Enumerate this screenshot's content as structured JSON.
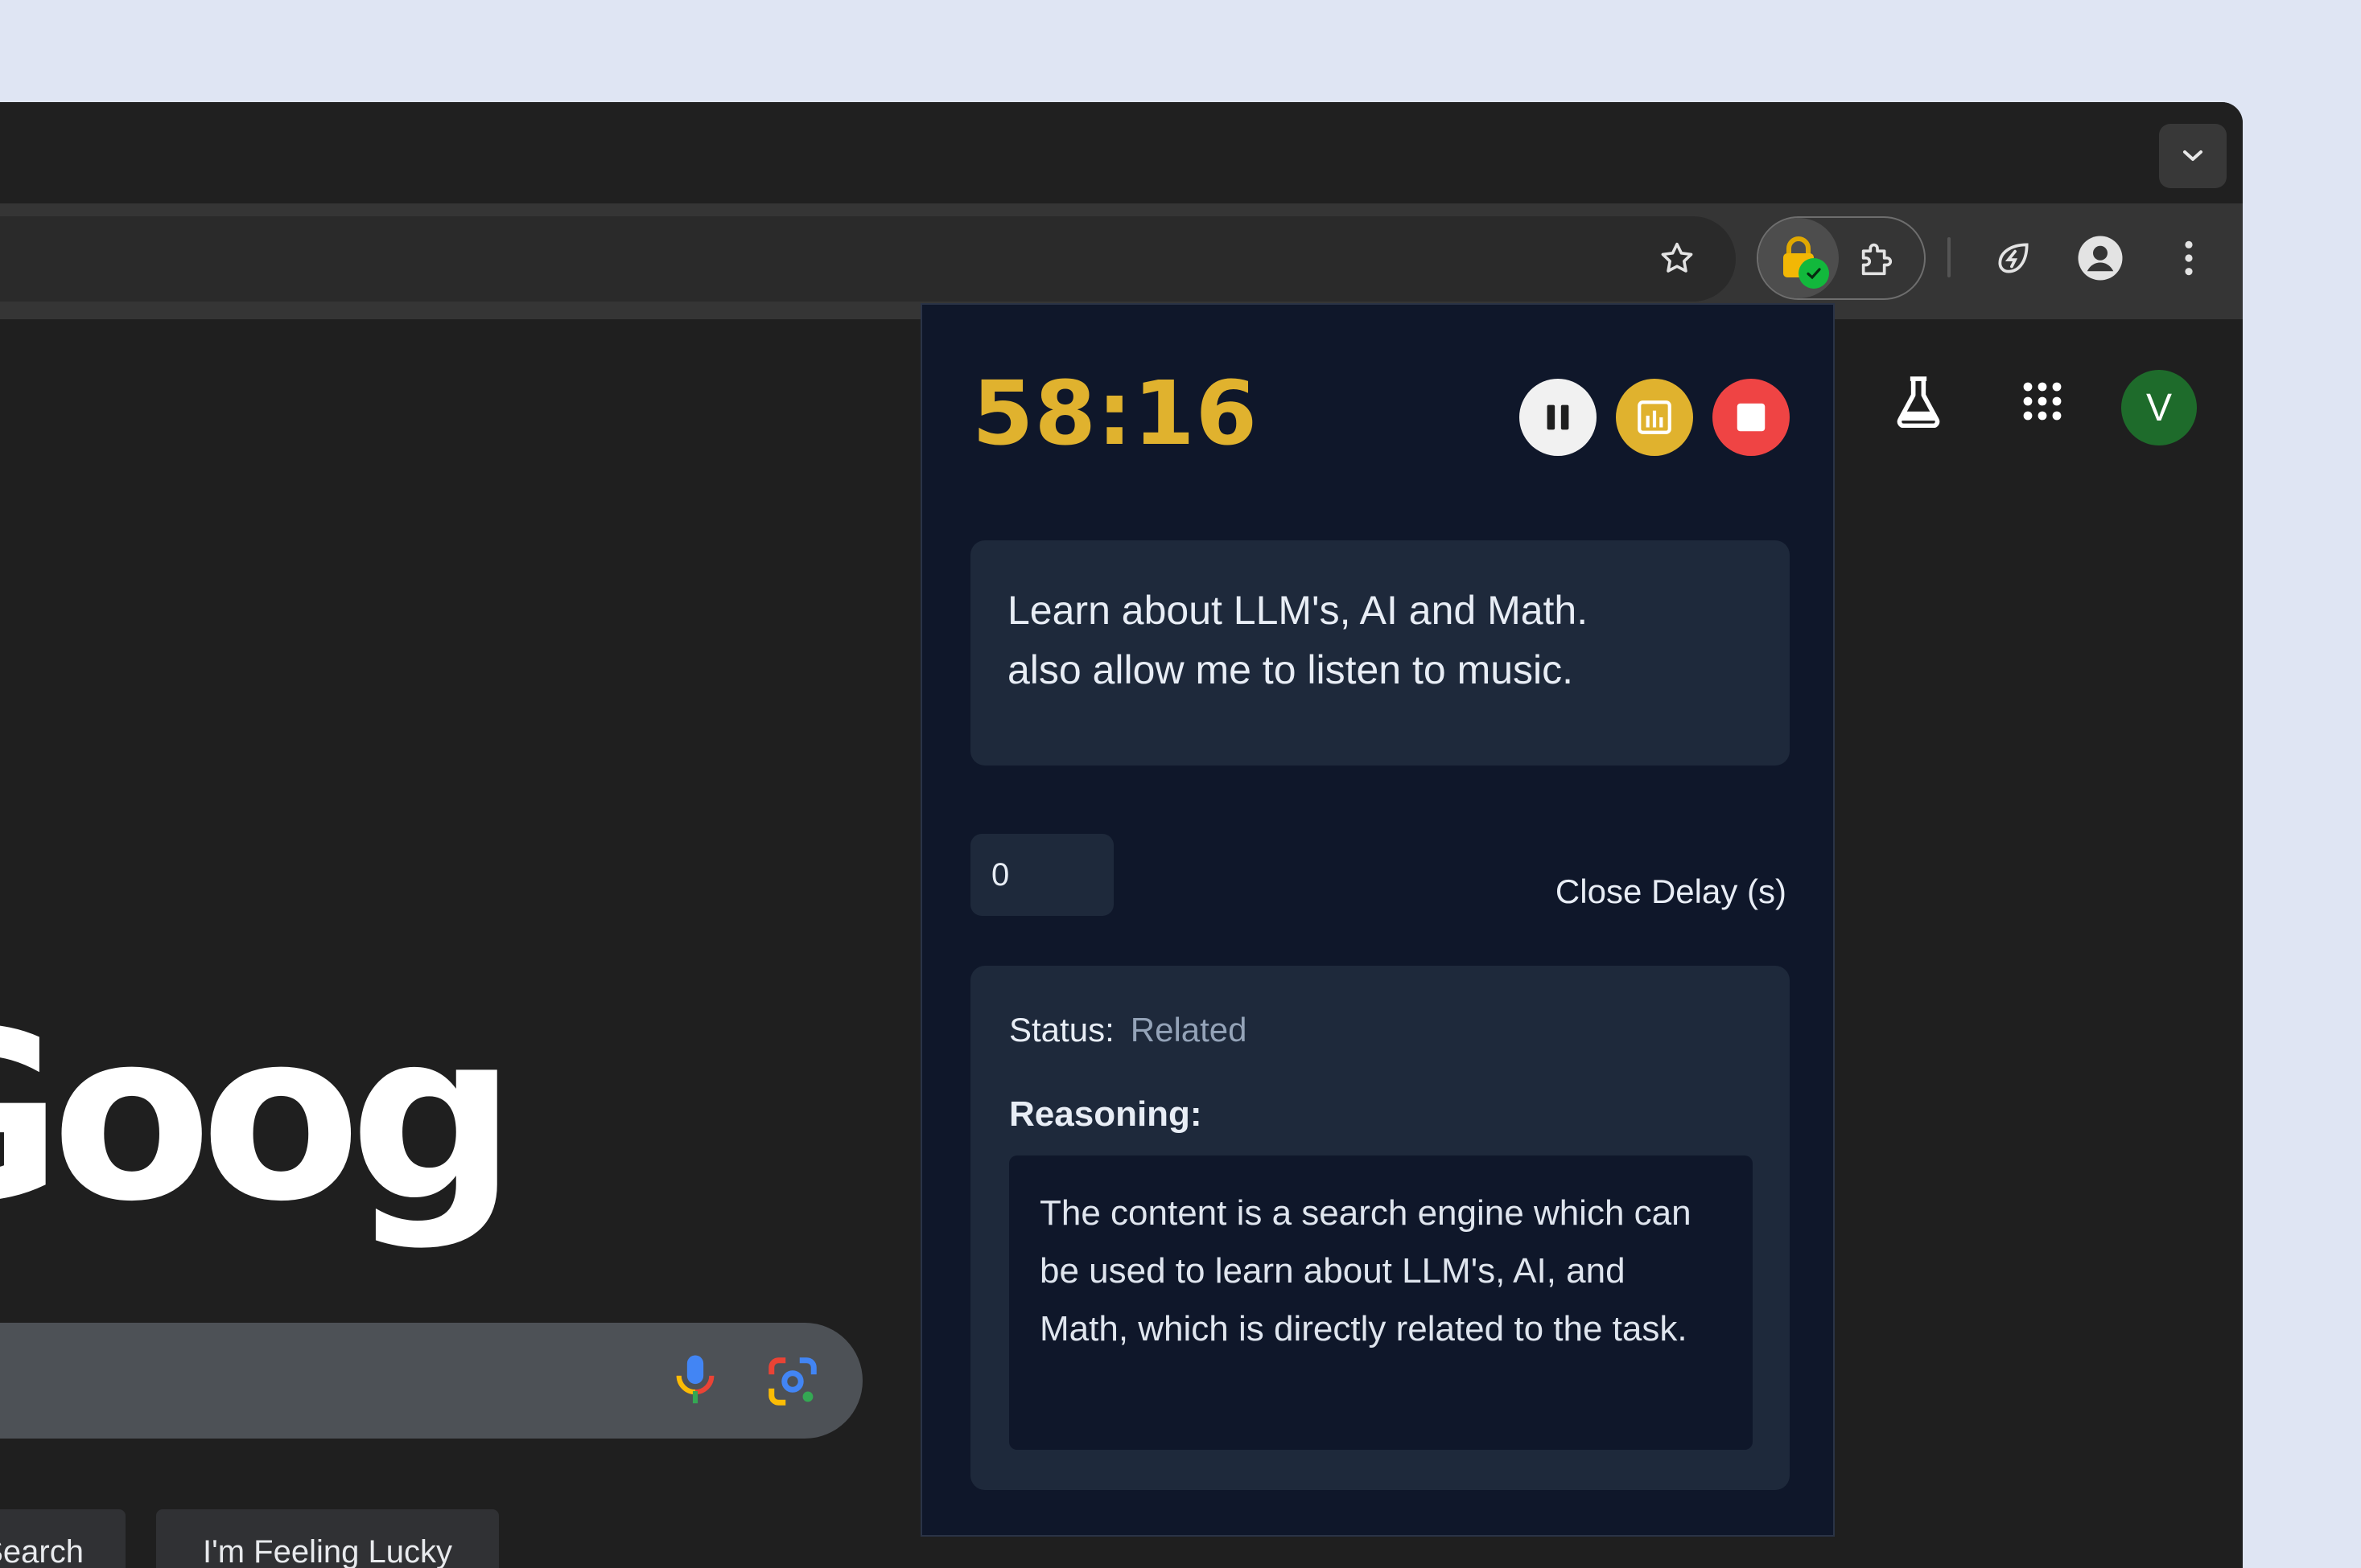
{
  "browser": {
    "toolbar": {
      "extensions": [
        "lock-extension",
        "puzzle-extensions",
        "performance-leaf",
        "profile",
        "menu"
      ]
    }
  },
  "google": {
    "avatar_letter": "V",
    "logo_text": "Google",
    "buttons": {
      "search": "Google Search",
      "lucky": "I'm Feeling Lucky"
    }
  },
  "focus_panel": {
    "timer": "58:16",
    "task_text": "Learn about LLM's, AI and Math.\nalso allow me to listen to music.",
    "close_delay_value": "0",
    "close_delay_label": "Close Delay (s)",
    "status_label": "Status:",
    "status_value": "Related",
    "reasoning_label": "Reasoning:",
    "reasoning_text": "The content is a search engine which can be used to learn about LLM's, AI, and Math, which is directly related to the task.",
    "colors": {
      "timer": "#e0b22e",
      "pause_btn": "#f1f1f1",
      "stats_btn": "#e0b22e",
      "stop_btn": "#ef4444",
      "panel_bg": "#0f172a",
      "card_bg": "#1e293b"
    }
  }
}
